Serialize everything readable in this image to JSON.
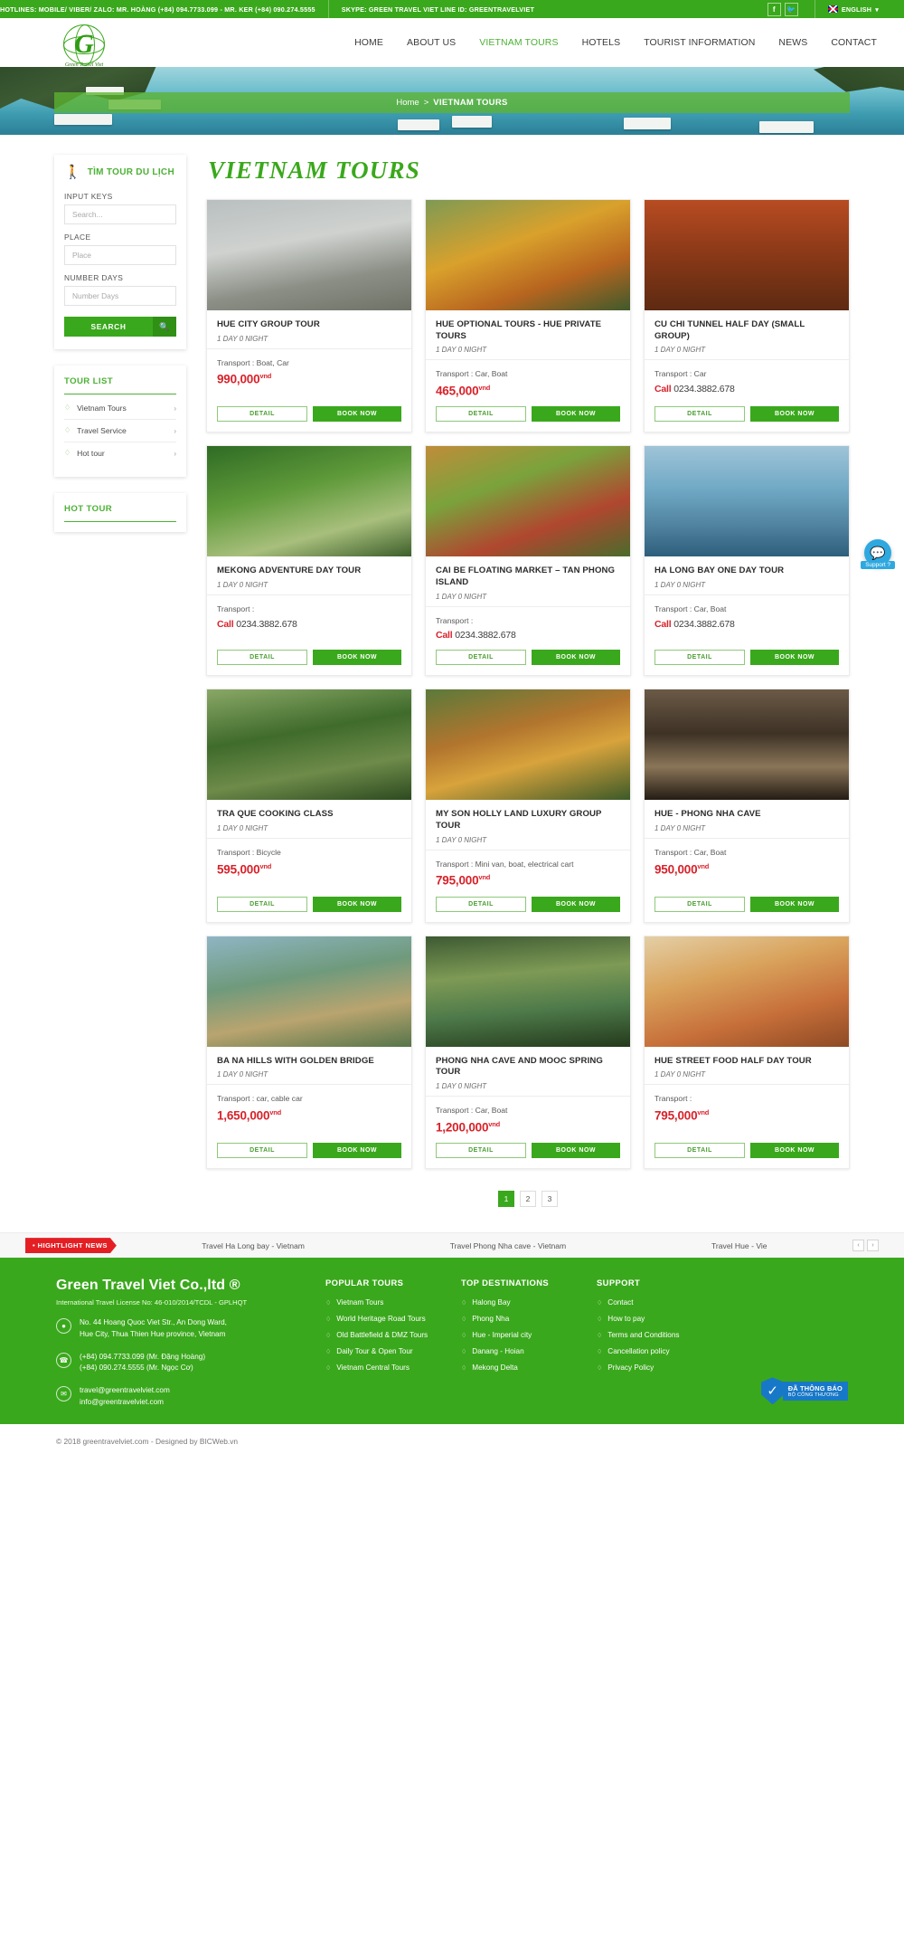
{
  "topbar": {
    "hotlines": "HOTLINES: MOBILE/ VIBER/ ZALO: MR. HOÀNG (+84) 094.7733.099 - MR. KER (+84) 090.274.5555",
    "skype": "SKYPE: GREEN TRAVEL VIET    LINE ID: GREENTRAVELVIET",
    "facebook_icon": "facebook-icon",
    "twitter_icon": "twitter-icon",
    "language": "ENGLISH",
    "language_caret": "▾"
  },
  "logo": {
    "letter": "G",
    "caption": "Green Travel Viet"
  },
  "nav": [
    {
      "label": "HOME",
      "active": false
    },
    {
      "label": "ABOUT US",
      "active": false
    },
    {
      "label": "VIETNAM TOURS",
      "active": true
    },
    {
      "label": "HOTELS",
      "active": false
    },
    {
      "label": "TOURIST INFORMATION",
      "active": false
    },
    {
      "label": "NEWS",
      "active": false
    },
    {
      "label": "CONTACT",
      "active": false
    }
  ],
  "breadcrumb": {
    "home": "Home",
    "separator": ">",
    "current": "VIETNAM TOURS"
  },
  "page_title": "VIETNAM TOURS",
  "search_widget": {
    "title": "TÌM TOUR DU LỊCH",
    "icon": "walking-person-icon",
    "fields": [
      {
        "label": "INPUT KEYS",
        "placeholder": "Search...",
        "value": ""
      },
      {
        "label": "PLACE",
        "placeholder": "Place",
        "value": ""
      },
      {
        "label": "NUMBER DAYS",
        "placeholder": "Number Days",
        "value": ""
      }
    ],
    "button_label": "SEARCH",
    "button_icon": "search-icon"
  },
  "tour_list_widget": {
    "title": "TOUR LIST",
    "items": [
      {
        "label": "Vietnam Tours"
      },
      {
        "label": "Travel Service"
      },
      {
        "label": "Hot tour"
      }
    ]
  },
  "hot_tour_widget": {
    "title": "HOT TOUR",
    "items": []
  },
  "buttons": {
    "detail": "DETAIL",
    "book": "BOOK NOW"
  },
  "tours": [
    {
      "title": "HUE CITY GROUP TOUR",
      "duration": "1 DAY 0 NIGHT",
      "transport": "Transport : Boat, Car",
      "price": "990,000",
      "currency": "vnd",
      "call": null,
      "img": "im1"
    },
    {
      "title": "HUE OPTIONAL TOURS - HUE PRIVATE TOURS",
      "duration": "1 DAY 0 NIGHT",
      "transport": "Transport : Car, Boat",
      "price": "465,000",
      "currency": "vnd",
      "call": null,
      "img": "im2"
    },
    {
      "title": "CU CHI TUNNEL HALF DAY (SMALL GROUP)",
      "duration": "1 DAY 0 NIGHT",
      "transport": "Transport : Car",
      "price": null,
      "currency": "vnd",
      "call": {
        "word": "Call",
        "number": "0234.3882.678"
      },
      "img": "im3"
    },
    {
      "title": "MEKONG ADVENTURE DAY TOUR",
      "duration": "1 DAY 0 NIGHT",
      "transport": "Transport :",
      "price": null,
      "currency": "vnd",
      "call": {
        "word": "Call",
        "number": "0234.3882.678"
      },
      "img": "im4"
    },
    {
      "title": "CAI BE FLOATING MARKET – TAN PHONG ISLAND",
      "duration": "1 DAY 0 NIGHT",
      "transport": "Transport :",
      "price": null,
      "currency": "vnd",
      "call": {
        "word": "Call",
        "number": "0234.3882.678"
      },
      "img": "im5"
    },
    {
      "title": "HA LONG BAY ONE DAY TOUR",
      "duration": "1 DAY 0 NIGHT",
      "transport": "Transport : Car, Boat",
      "price": null,
      "currency": "vnd",
      "call": {
        "word": "Call",
        "number": "0234.3882.678"
      },
      "img": "im6"
    },
    {
      "title": "TRA QUE COOKING CLASS",
      "duration": "1 DAY 0 NIGHT",
      "transport": "Transport : Bicycle",
      "price": "595,000",
      "currency": "vnd",
      "call": null,
      "img": "im7"
    },
    {
      "title": "MY SON HOLLY LAND LUXURY GROUP TOUR",
      "duration": "1 DAY 0 NIGHT",
      "transport": "Transport : Mini van, boat, electrical cart",
      "price": "795,000",
      "currency": "vnd",
      "call": null,
      "img": "im8"
    },
    {
      "title": "HUE - PHONG NHA CAVE",
      "duration": "1 DAY 0 NIGHT",
      "transport": "Transport : Car, Boat",
      "price": "950,000",
      "currency": "vnd",
      "call": null,
      "img": "im9"
    },
    {
      "title": "BA NA HILLS WITH GOLDEN BRIDGE",
      "duration": "1 DAY 0 NIGHT",
      "transport": "Transport : car, cable car",
      "price": "1,650,000",
      "currency": "vnd",
      "call": null,
      "img": "im10"
    },
    {
      "title": "PHONG NHA CAVE AND MOOC SPRING TOUR",
      "duration": "1 DAY 0 NIGHT",
      "transport": "Transport : Car, Boat",
      "price": "1,200,000",
      "currency": "vnd",
      "call": null,
      "img": "im11"
    },
    {
      "title": "HUE STREET FOOD HALF DAY TOUR",
      "duration": "1 DAY 0 NIGHT",
      "transport": "Transport :",
      "price": "795,000",
      "currency": "vnd",
      "call": null,
      "img": "im12"
    }
  ],
  "pagination": {
    "pages": [
      "1",
      "2",
      "3"
    ],
    "active": "1"
  },
  "ticker": {
    "badge": "• HIGHTLIGHT NEWS",
    "items": [
      "Travel Ha Long bay - Vietnam",
      "Travel Phong Nha cave - Vietnam",
      "Travel Hue - Vie"
    ],
    "prev": "‹",
    "next": "›"
  },
  "support": {
    "label": "Support ?",
    "icon": "chat-bubble-icon"
  },
  "footer": {
    "brand": "Green Travel Viet Co.,ltd ®",
    "license": "International Travel License No: 46-010/2014/TCDL - GPLHQT",
    "address_icon": "map-pin-icon",
    "address": "No. 44 Hoang Quoc Viet Str., An Dong Ward,\nHue City, Thua Thien Hue province, Vietnam",
    "phone_icon": "phone-icon",
    "phones": "(+84) 094.7733.099 (Mr. Đặng Hoàng)\n(+84) 090.274.5555 (Mr. Ngọc Cơ)",
    "email_icon": "envelope-icon",
    "emails": "travel@greentravelviet.com\ninfo@greentravelviet.com",
    "columns": [
      {
        "title": "POPULAR TOURS",
        "links": [
          "Vietnam Tours",
          "World Heritage Road Tours",
          "Old Battlefield & DMZ Tours",
          "Daily Tour & Open Tour",
          "Vietnam Central Tours"
        ]
      },
      {
        "title": "TOP DESTINATIONS",
        "links": [
          "Halong Bay",
          "Phong Nha",
          "Hue - Imperial city",
          "Danang - Hoian",
          "Mekong Delta"
        ]
      },
      {
        "title": "SUPPORT",
        "links": [
          "Contact",
          "How to pay",
          "Terms and Conditions",
          "Cancellation policy",
          "Privacy Policy"
        ]
      }
    ],
    "certificate": {
      "line1": "ĐÃ THÔNG BÁO",
      "line2": "BỘ CÔNG THƯƠNG",
      "icon": "check-shield-icon"
    },
    "copyright": "© 2018 greentravelviet.com - Designed by BICWeb.vn"
  },
  "colors": {
    "brand_green": "#3aa81c",
    "nav_active": "#4cb135",
    "price_red": "#d8222a",
    "news_red": "#e41f24",
    "support_blue": "#2fa8e0",
    "cert_blue": "#1878c8"
  }
}
